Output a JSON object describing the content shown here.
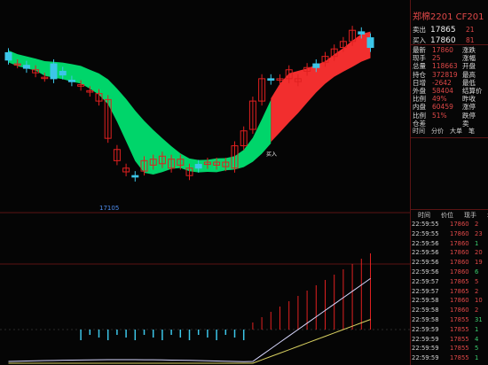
{
  "colors": {
    "up": "#e02020",
    "down": "#3cc6e8",
    "green_band": "#00e070",
    "red_band": "#ff3030",
    "bg": "#050505",
    "border": "#5a1414"
  },
  "chart": {
    "low_label": "17105",
    "buy_label": "买入",
    "candles": [
      {
        "o": 17865,
        "c": 17855
      },
      {
        "o": 17850,
        "c": 17850
      },
      {
        "o": 17848,
        "c": 17844
      },
      {
        "o": 17838,
        "c": 17842
      },
      {
        "o": 17832,
        "c": 17832
      },
      {
        "o": 17850,
        "c": 17830
      },
      {
        "o": 17840,
        "c": 17835
      },
      {
        "o": 17828,
        "c": 17826
      },
      {
        "o": 17820,
        "c": 17822
      },
      {
        "o": 17812,
        "c": 17814
      },
      {
        "o": 17800,
        "c": 17810
      },
      {
        "o": 17750,
        "c": 17802
      },
      {
        "o": 17720,
        "c": 17735
      },
      {
        "o": 17705,
        "c": 17710
      },
      {
        "o": 17700,
        "c": 17698
      },
      {
        "o": 17706,
        "c": 17720
      },
      {
        "o": 17714,
        "c": 17722
      },
      {
        "o": 17716,
        "c": 17726
      },
      {
        "o": 17710,
        "c": 17722
      },
      {
        "o": 17714,
        "c": 17722
      },
      {
        "o": 17700,
        "c": 17710
      },
      {
        "o": 17715,
        "c": 17710
      },
      {
        "o": 17715,
        "c": 17718
      },
      {
        "o": 17714,
        "c": 17718
      },
      {
        "o": 17712,
        "c": 17718
      },
      {
        "o": 17710,
        "c": 17740
      },
      {
        "o": 17740,
        "c": 17760
      },
      {
        "o": 17762,
        "c": 17800
      },
      {
        "o": 17800,
        "c": 17830
      },
      {
        "o": 17830,
        "c": 17828
      },
      {
        "o": 17828,
        "c": 17830
      },
      {
        "o": 17830,
        "c": 17842
      },
      {
        "o": 17826,
        "c": 17830
      },
      {
        "o": 17840,
        "c": 17845
      },
      {
        "o": 17850,
        "c": 17845
      },
      {
        "o": 17852,
        "c": 17860
      },
      {
        "o": 17860,
        "c": 17870
      },
      {
        "o": 17872,
        "c": 17880
      },
      {
        "o": 17880,
        "c": 17895
      },
      {
        "o": 17893,
        "c": 17890
      },
      {
        "o": 17885,
        "c": 17872
      }
    ]
  },
  "panel": {
    "title": "郑棉2201 CF201",
    "quotes": [
      {
        "label": "卖出",
        "value": "17865",
        "vol": "21"
      },
      {
        "label": "买入",
        "value": "17860",
        "vol": "81"
      }
    ],
    "stats_left": [
      {
        "label": "最新",
        "value": "17860"
      },
      {
        "label": "现手",
        "value": "25"
      },
      {
        "label": "总量",
        "value": "118663"
      },
      {
        "label": "持仓",
        "value": "372819"
      },
      {
        "label": "日增",
        "value": "-2642"
      },
      {
        "label": "外盘",
        "value": "58404"
      },
      {
        "label": "比例",
        "value": "49%"
      },
      {
        "label": "内盘",
        "value": "60459"
      },
      {
        "label": "比例",
        "value": "51%"
      },
      {
        "label": "仓差",
        "value": ""
      }
    ],
    "stats_right": [
      "涨跌",
      "涨幅",
      "开盘",
      "最高",
      "最低",
      "结算价",
      "昨收",
      "涨停",
      "跌停",
      "卖",
      "买"
    ],
    "tabs": [
      "时间",
      "分价",
      "大单",
      "笔"
    ],
    "ticks_header": [
      "时间",
      "价位",
      "现手",
      "增仓"
    ],
    "ticks": [
      {
        "time": "22:59:55",
        "price": "17860",
        "vol": "2",
        "d": "up"
      },
      {
        "time": "22:59:55",
        "price": "17860",
        "vol": "23",
        "d": "up"
      },
      {
        "time": "22:59:56",
        "price": "17860",
        "vol": "1",
        "d": "dn"
      },
      {
        "time": "22:59:56",
        "price": "17860",
        "vol": "20",
        "d": "up"
      },
      {
        "time": "22:59:56",
        "price": "17860",
        "vol": "19",
        "d": "up"
      },
      {
        "time": "22:59:56",
        "price": "17860",
        "vol": "6",
        "d": "dn"
      },
      {
        "time": "22:59:57",
        "price": "17865",
        "vol": "5",
        "d": "up"
      },
      {
        "time": "22:59:57",
        "price": "17865",
        "vol": "2",
        "d": "up"
      },
      {
        "time": "22:59:58",
        "price": "17860",
        "vol": "10",
        "d": "up"
      },
      {
        "time": "22:59:58",
        "price": "17860",
        "vol": "2",
        "d": "up"
      },
      {
        "time": "22:59:58",
        "price": "17855",
        "vol": "31",
        "d": "dn"
      },
      {
        "time": "22:59:59",
        "price": "17855",
        "vol": "1",
        "d": "dn"
      },
      {
        "time": "22:59:59",
        "price": "17855",
        "vol": "4",
        "d": "dn"
      },
      {
        "time": "22:59:59",
        "price": "17855",
        "vol": "5",
        "d": "dn"
      },
      {
        "time": "22:59:59",
        "price": "17855",
        "vol": "1",
        "d": "dn"
      }
    ]
  }
}
